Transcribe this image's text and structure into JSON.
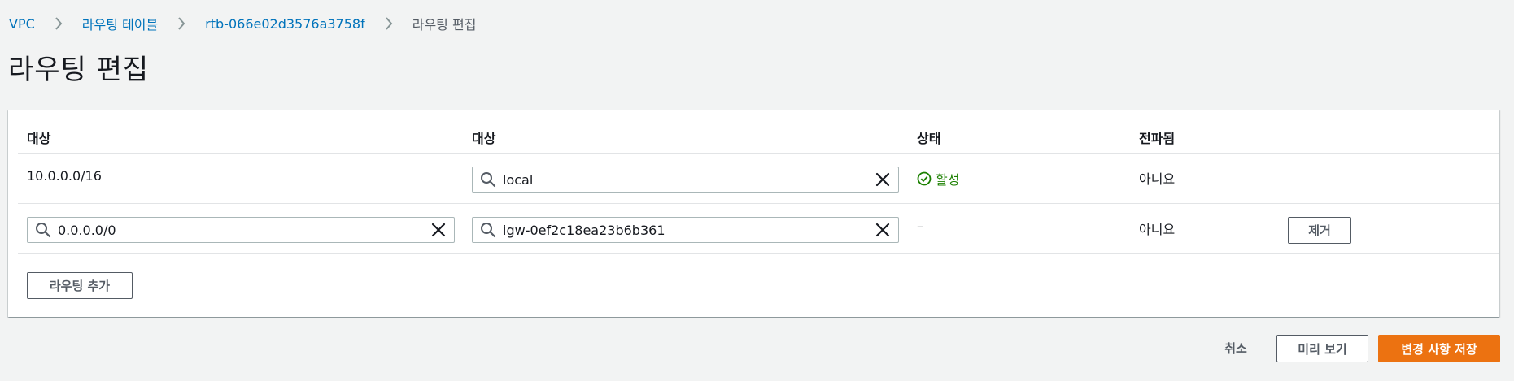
{
  "breadcrumb": {
    "items": [
      {
        "label": "VPC"
      },
      {
        "label": "라우팅 테이블"
      },
      {
        "label": "rtb-066e02d3576a3758f"
      },
      {
        "label": "라우팅 편집"
      }
    ]
  },
  "page": {
    "title": "라우팅 편집"
  },
  "table": {
    "columns": [
      "대상",
      "대상",
      "상태",
      "전파됨"
    ],
    "rows": [
      {
        "destination": "10.0.0.0/16",
        "target": "local",
        "status": "활성",
        "propagated": "아니요"
      },
      {
        "destination": "0.0.0.0/0",
        "target": "igw-0ef2c18ea23b6b361",
        "status": "–",
        "propagated": "아니요",
        "remove_label": "제거"
      }
    ],
    "add_route_label": "라우팅 추가"
  },
  "footer": {
    "cancel_label": "취소",
    "preview_label": "미리 보기",
    "save_label": "변경 사항 저장"
  },
  "colors": {
    "link": "#0073bb",
    "status_active": "#1d8102",
    "primary": "#ec7211",
    "background": "#f2f3f3"
  },
  "icons": {
    "breadcrumb_separator": "chevron-right-icon",
    "input_search": "search-icon",
    "input_clear": "close-icon",
    "status_active": "check-circle-icon"
  }
}
